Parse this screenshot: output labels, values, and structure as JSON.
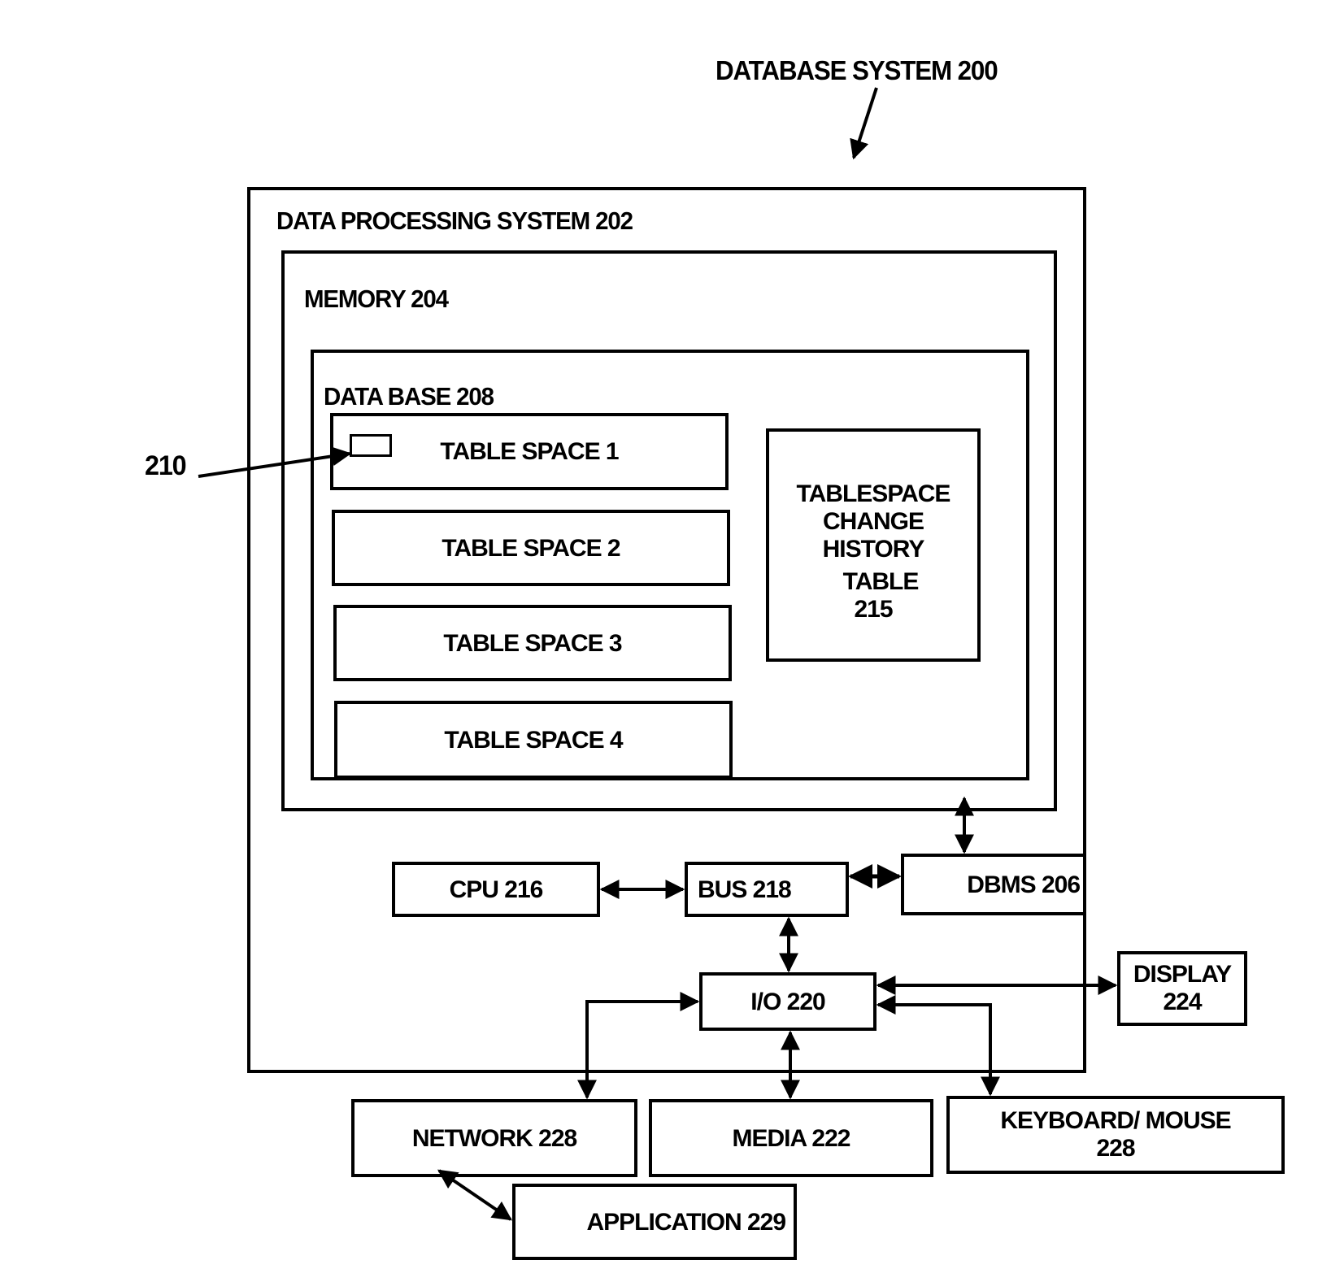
{
  "figure": {
    "title": "DATABASE SYSTEM 200",
    "callout_210": "210"
  },
  "data_processing_system": {
    "label": "DATA PROCESSING  SYSTEM 202"
  },
  "memory": {
    "label": "MEMORY 204"
  },
  "database": {
    "label": "DATA BASE  208"
  },
  "table_spaces": [
    {
      "label": "TABLE SPACE 1"
    },
    {
      "label": "TABLE SPACE 2"
    },
    {
      "label": "TABLE SPACE 3"
    },
    {
      "label": "TABLE SPACE 4"
    }
  ],
  "history_table": {
    "line1": "TABLESPACE",
    "line2": "CHANGE",
    "line3": "HISTORY",
    "line4": "TABLE",
    "line5": "215"
  },
  "components": {
    "cpu": "CPU  216",
    "bus": "BUS  218",
    "dbms": "DBMS  206",
    "io": "I/O  220",
    "display_line1": "DISPLAY",
    "display_line2": "224",
    "network": "NETWORK  228",
    "media": "MEDIA 222",
    "keyboard_line1": "KEYBOARD/ MOUSE",
    "keyboard_line2": "228",
    "application": "APPLICATION  229"
  }
}
